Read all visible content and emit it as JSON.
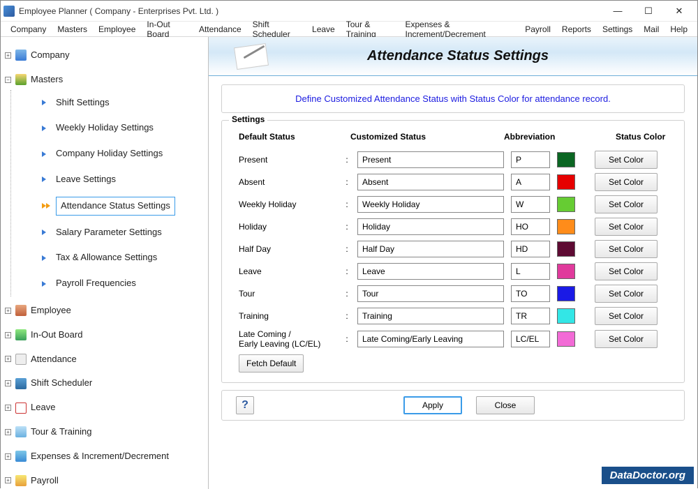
{
  "window": {
    "title": "Employee Planner ( Company - Enterprises Pvt. Ltd. )"
  },
  "menubar": [
    "Company",
    "Masters",
    "Employee",
    "In-Out Board",
    "Attendance",
    "Shift Scheduler",
    "Leave",
    "Tour & Training",
    "Expenses & Increment/Decrement",
    "Payroll",
    "Reports",
    "Settings",
    "Mail",
    "Help"
  ],
  "sidebar": {
    "nodes": [
      {
        "label": "Company",
        "icon": "ic-company",
        "expanded": false
      },
      {
        "label": "Masters",
        "icon": "ic-masters",
        "expanded": true,
        "children": [
          {
            "label": "Shift Settings",
            "selected": false
          },
          {
            "label": "Weekly Holiday Settings",
            "selected": false
          },
          {
            "label": "Company Holiday Settings",
            "selected": false
          },
          {
            "label": "Leave Settings",
            "selected": false
          },
          {
            "label": "Attendance Status Settings",
            "selected": true
          },
          {
            "label": "Salary Parameter Settings",
            "selected": false
          },
          {
            "label": "Tax & Allowance Settings",
            "selected": false
          },
          {
            "label": "Payroll Frequencies",
            "selected": false
          }
        ]
      },
      {
        "label": "Employee",
        "icon": "ic-employee",
        "expanded": false
      },
      {
        "label": "In-Out Board",
        "icon": "ic-inout",
        "expanded": false
      },
      {
        "label": "Attendance",
        "icon": "ic-attend",
        "expanded": false
      },
      {
        "label": "Shift Scheduler",
        "icon": "ic-shift",
        "expanded": false
      },
      {
        "label": "Leave",
        "icon": "ic-leave",
        "expanded": false
      },
      {
        "label": "Tour & Training",
        "icon": "ic-tour",
        "expanded": false
      },
      {
        "label": "Expenses & Increment/Decrement",
        "icon": "ic-exp",
        "expanded": false
      },
      {
        "label": "Payroll",
        "icon": "ic-pay",
        "expanded": false
      }
    ]
  },
  "main": {
    "title": "Attendance Status Settings",
    "description": "Define Customized Attendance Status with Status Color for attendance record.",
    "group_legend": "Settings",
    "headers": {
      "default": "Default Status",
      "custom": "Customized Status",
      "abbr": "Abbreviation",
      "color": "Status Color"
    },
    "set_color_label": "Set Color",
    "fetch_default_label": "Fetch Default",
    "rows": [
      {
        "default": "Present",
        "custom": "Present",
        "abbr": "P",
        "color": "#0B6623"
      },
      {
        "default": "Absent",
        "custom": "Absent",
        "abbr": "A",
        "color": "#E60000"
      },
      {
        "default": "Weekly Holiday",
        "custom": "Weekly Holiday",
        "abbr": "W",
        "color": "#66CC33"
      },
      {
        "default": "Holiday",
        "custom": "Holiday",
        "abbr": "HO",
        "color": "#FF8C1A"
      },
      {
        "default": "Half Day",
        "custom": "Half Day",
        "abbr": "HD",
        "color": "#5E0B33"
      },
      {
        "default": "Leave",
        "custom": "Leave",
        "abbr": "L",
        "color": "#E03A9C"
      },
      {
        "default": "Tour",
        "custom": "Tour",
        "abbr": "TO",
        "color": "#1A1AE6"
      },
      {
        "default": "Training",
        "custom": "Training",
        "abbr": "TR",
        "color": "#33E6E6"
      },
      {
        "default": "Late Coming /\nEarly Leaving (LC/EL)",
        "custom": "Late Coming/Early Leaving",
        "abbr": "LC/EL",
        "color": "#F26BD6"
      }
    ],
    "footer": {
      "apply": "Apply",
      "close": "Close"
    }
  },
  "watermark": "DataDoctor.org"
}
